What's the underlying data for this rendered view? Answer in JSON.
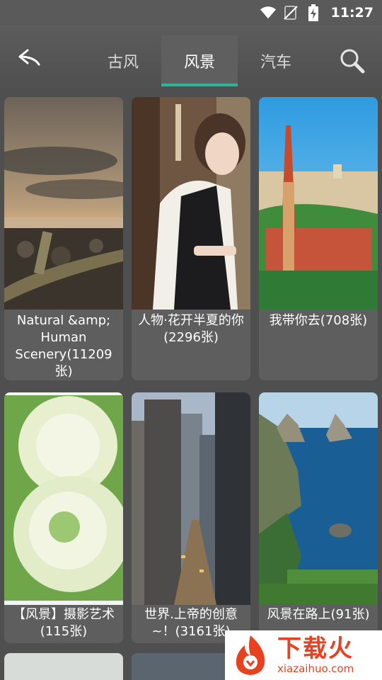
{
  "status": {
    "time": "11:27"
  },
  "tabs": [
    {
      "label": "古风",
      "active": false
    },
    {
      "label": "风景",
      "active": true
    },
    {
      "label": "汽车",
      "active": false
    }
  ],
  "albums": [
    {
      "caption": "Natural &amp; Human Scenery(11209张)",
      "image": "sunset-shore-photo"
    },
    {
      "caption": "人物·花开半夏的你(2296张)",
      "image": "girl-portrait-photo"
    },
    {
      "caption": "我带你去(708张)",
      "image": "budapest-church-photo"
    },
    {
      "caption": "【风景】摄影艺术(115张)",
      "image": "white-flowers-photo"
    },
    {
      "caption": "世界.上帝的创意~！(3161张)",
      "image": "city-skyscrapers-photo"
    },
    {
      "caption": "风景在路上(91张)",
      "image": "coast-cliffs-photo"
    }
  ],
  "watermark": {
    "title": "下载火",
    "subtitle": "xiazaihuo.com"
  },
  "colors": {
    "accent": "#2fb39a",
    "background": "#4f4f4f",
    "card": "#5e5e5e",
    "watermark": "#e8411f"
  }
}
